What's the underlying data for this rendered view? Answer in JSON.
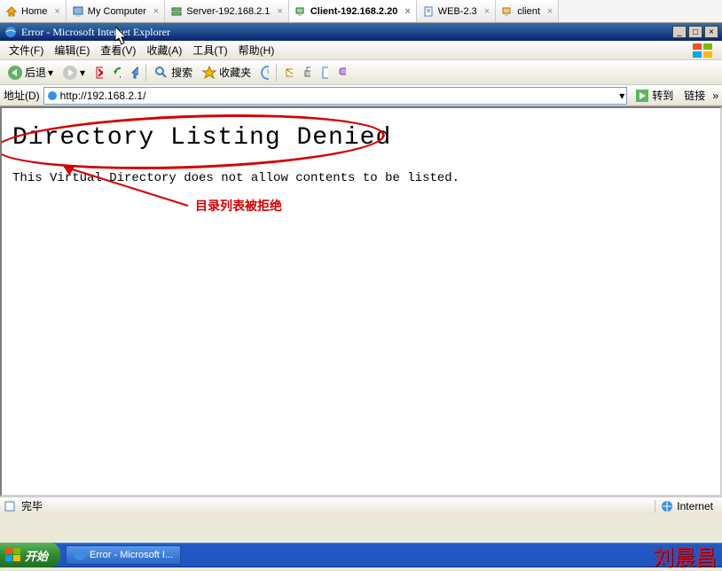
{
  "tabs": [
    {
      "label": "Home",
      "icon": "home-icon"
    },
    {
      "label": "My Computer",
      "icon": "computer-icon"
    },
    {
      "label": "Server-192.168.2.1",
      "icon": "server-icon"
    },
    {
      "label": "Client-192.168.2.20",
      "icon": "client-icon",
      "active": true
    },
    {
      "label": "WEB-2.3",
      "icon": "page-icon"
    },
    {
      "label": "client",
      "icon": "client-icon"
    }
  ],
  "ie": {
    "title": "Error - Microsoft Internet Explorer",
    "menus": {
      "file": "文件(F)",
      "edit": "编辑(E)",
      "view": "查看(V)",
      "favorites": "收藏(A)",
      "tools": "工具(T)",
      "help": "帮助(H)"
    },
    "toolbar": {
      "back": "后退",
      "search": "搜索",
      "favorites": "收藏夹"
    },
    "address": {
      "label": "地址(D)",
      "url": "http://192.168.2.1/",
      "go": "转到",
      "links": "链接"
    },
    "status": {
      "done": "完毕",
      "zone": "Internet"
    }
  },
  "page": {
    "heading": "Directory Listing Denied",
    "body": "This Virtual Directory does not allow contents to be listed."
  },
  "annotation": {
    "text": "目录列表被拒绝"
  },
  "taskbar": {
    "start": "开始",
    "task": "Error - Microsoft I...",
    "signature": "刘晨昌"
  }
}
